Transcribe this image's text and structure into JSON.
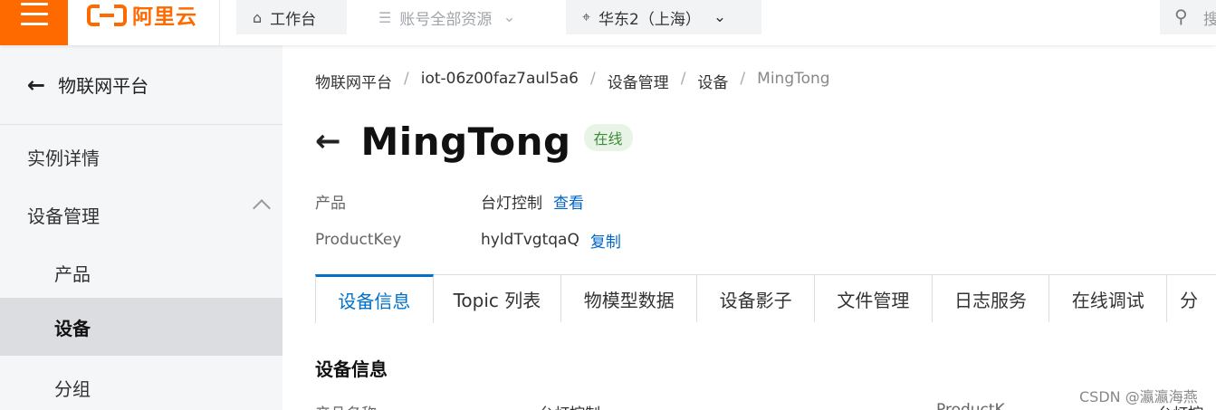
{
  "topbar": {
    "logo_text": "阿里云",
    "workbench": "工作台",
    "resources": "账号全部资源",
    "region": "华东2（上海）",
    "search_placeholder": "搜"
  },
  "sidebar": {
    "back_title": "物联网平台",
    "items": [
      {
        "label": "实例详情"
      },
      {
        "label": "设备管理"
      },
      {
        "label": "产品"
      },
      {
        "label": "设备"
      },
      {
        "label": "分组"
      }
    ]
  },
  "breadcrumb": [
    "物联网平台",
    "iot-06z00faz7aul5a6",
    "设备管理",
    "设备",
    "MingTong"
  ],
  "device": {
    "name": "MingTong",
    "status": "在线",
    "product_label": "产品",
    "product_value": "台灯控制",
    "product_link": "查看",
    "productkey_label": "ProductKey",
    "productkey_value": "hyldTvgtqaQ",
    "productkey_link": "复制"
  },
  "tabs": [
    {
      "label": "设备信息"
    },
    {
      "label": "Topic 列表"
    },
    {
      "label": "物模型数据"
    },
    {
      "label": "设备影子"
    },
    {
      "label": "文件管理"
    },
    {
      "label": "日志服务"
    },
    {
      "label": "在线调试"
    },
    {
      "label": "分"
    }
  ],
  "section": {
    "title": "设备信息",
    "row": [
      "产品名称",
      "台灯控制",
      "ProductK",
      "台灯控"
    ]
  },
  "watermark": "CSDN @瀛瀛海燕"
}
